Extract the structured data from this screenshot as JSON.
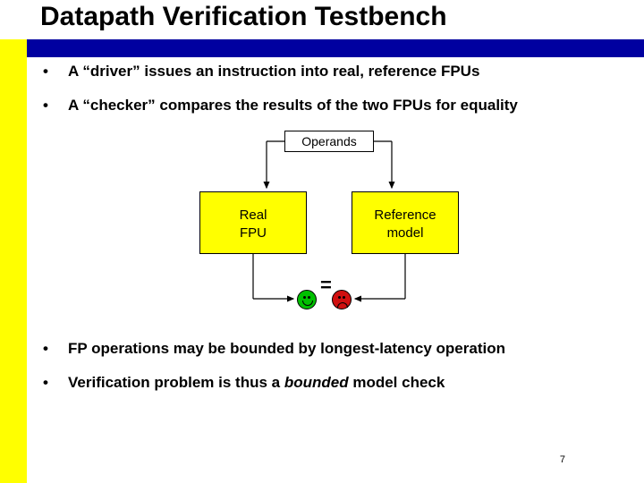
{
  "title": "Datapath Verification Testbench",
  "bullets": {
    "b1_pre": "A “driver” issues an instruction into real, reference FPUs",
    "b2_pre": "A “checker” compares the results of the two FPUs for equality",
    "b3": "FP operations may be bounded by longest-latency operation",
    "b4_pre": "Verification problem is thus a ",
    "b4_em": "bounded",
    "b4_post": " model check"
  },
  "diagram": {
    "operands": "Operands",
    "real_fpu_l1": "Real",
    "real_fpu_l2": "FPU",
    "ref_l1": "Reference",
    "ref_l2": "model",
    "equals": "="
  },
  "page": "7"
}
